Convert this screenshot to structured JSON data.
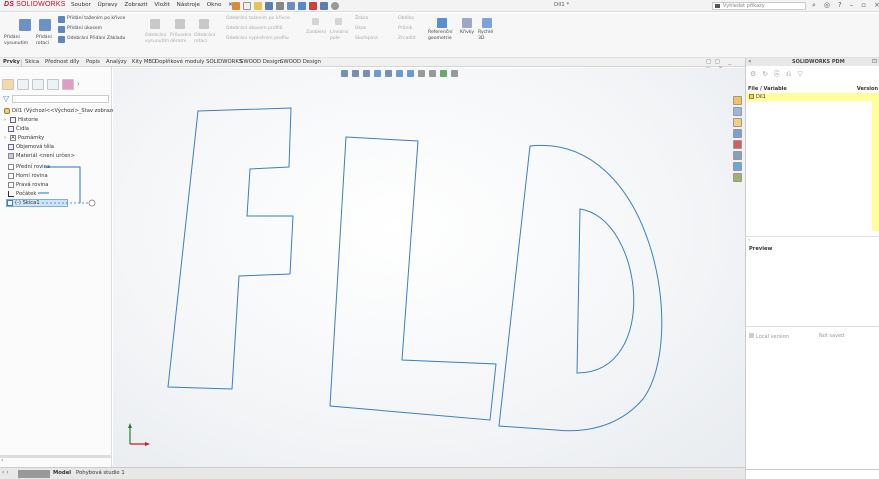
{
  "app": {
    "logo_ds": "DS",
    "logo_name": "SOLIDWORKS",
    "document_title": "Díl1 *",
    "search_placeholder": "Vyhledat příkazy"
  },
  "menu": [
    "Soubor",
    "Úpravy",
    "Zobrazit",
    "Vložit",
    "Nástroje",
    "Okno"
  ],
  "window_controls": [
    "?",
    "–",
    "▫",
    "×"
  ],
  "ribbon": {
    "items": [
      {
        "label": "Přidání tažením po křivce"
      },
      {
        "label": "Přidání úkosem"
      },
      {
        "label": "Přidání vysunutí"
      },
      {
        "label": "Vytvoření vyplněním profilu"
      },
      {
        "label": "Odebrání Přidání Základu"
      },
      {
        "label": "Zaoblení"
      },
      {
        "label": "Lineární pole"
      },
      {
        "label": "Žebro"
      },
      {
        "label": "Skořepina"
      },
      {
        "label": "Obálka"
      },
      {
        "label": "Průnik"
      },
      {
        "label": "Zrcadlit"
      },
      {
        "label": "Referenční geometrie"
      },
      {
        "label": "Křivky"
      },
      {
        "label": "Instant3D"
      }
    ]
  },
  "tabs": [
    "Prvky",
    "Skica",
    "Přednost díly",
    "Popis",
    "Analýzy",
    "Kity MBD",
    "Doplňkové moduly SOLIDWORKS",
    "SWOOD Design",
    "SWOOD Design"
  ],
  "feature_tree": {
    "root": "Díl1 (Výchozí<<Výchozí>_Stav zobrazení 1>)",
    "nodes": [
      {
        "label": "Historie"
      },
      {
        "label": "Čidla"
      },
      {
        "label": "Poznámky"
      },
      {
        "label": "Objemová těla"
      },
      {
        "label": "Materiál <není určen>"
      },
      {
        "label": "Přední rovina"
      },
      {
        "label": "Horní rovina"
      },
      {
        "label": "Pravá rovina"
      },
      {
        "label": "Počátek"
      },
      {
        "label": "(-) Skica1"
      }
    ]
  },
  "bottom_tabs": [
    "Model",
    "Pohybová studie 1"
  ],
  "pdm_panel": {
    "title": "SOLIDWORKS PDM",
    "col_file": "File / Variable",
    "col_version": "Version",
    "row_file": "Díl1",
    "preview_label": "Preview",
    "local_version": "Local version",
    "not_saved": "Not saved"
  },
  "colors": {
    "sketch_line": "#3a7fc1",
    "selection_bg": "#cfe4f7",
    "pdm_highlight": "#ffff99",
    "brand_red": "#c8102e"
  },
  "sketch_text": "FLD",
  "icons": [
    "home-icon",
    "new-icon",
    "open-icon",
    "save-icon",
    "print-icon",
    "undo-icon",
    "select-icon",
    "rebuild-icon",
    "options-icon",
    "search-icon",
    "help-icon",
    "filter-icon"
  ]
}
